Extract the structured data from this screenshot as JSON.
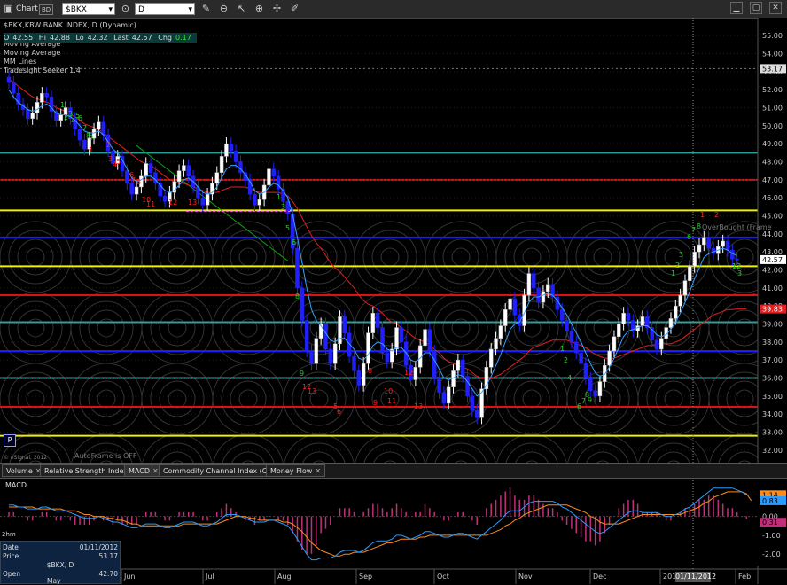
{
  "toolbar": {
    "window_title": "Chart",
    "window_badge": "BD",
    "symbol_value": "$BKX",
    "interval_value": "D",
    "tools": [
      "link-icon",
      "refresh-icon",
      "pencil-icon",
      "zoom-icon",
      "cursor-icon",
      "bell-icon",
      "pin-icon",
      "draw-icon"
    ],
    "window_buttons": [
      "minimize-icon",
      "maximize-icon",
      "close-icon"
    ]
  },
  "study": {
    "title": "$BKX,KBW BANK INDEX, D (Dynamic)",
    "overlay_1": "Moving Average",
    "overlay_2": "Moving Average",
    "overlay_3": "MM Lines",
    "overlay_4": "Tradesight Seeker 1.4",
    "overbought_label": "OverBought (Frame"
  },
  "quote": {
    "open_label": "O",
    "open_value": "42.55",
    "high_label": "Hi",
    "high_value": "42.88",
    "low_label": "Lo",
    "low_value": "42.32",
    "last_label": "Last",
    "last_value": "42.57",
    "chg_label": "Chg",
    "chg_value": "0.17"
  },
  "status": {
    "autoframe": "AutoFrame is OFF",
    "copyright": "© eSignal, 2012",
    "p_button": "P"
  },
  "price_axis": {
    "ticks": [
      "55.00",
      "54.00",
      "53.00",
      "52.00",
      "51.00",
      "50.00",
      "49.00",
      "48.00",
      "47.00",
      "46.00",
      "45.00",
      "44.00",
      "43.00",
      "42.00",
      "41.00",
      "40.00",
      "39.00",
      "38.00",
      "37.00",
      "36.00",
      "35.00",
      "34.00",
      "33.00",
      "32.00"
    ],
    "cursor_price": "53.17",
    "last_price": "42.57",
    "ma_price": "39.83"
  },
  "date_axis": {
    "labels": [
      "Jun",
      "Jul",
      "Aug",
      "Sep",
      "Oct",
      "Nov",
      "Dec",
      "201",
      "Feb"
    ],
    "cursor_date": "01/11/2012"
  },
  "indicator_tabs": [
    {
      "label": "Volume",
      "active": false
    },
    {
      "label": "Relative Strength Index",
      "active": false
    },
    {
      "label": "MACD",
      "active": true
    },
    {
      "label": "Commodity Channel Index (CCI)",
      "active": false
    },
    {
      "label": "Money Flow",
      "active": false
    }
  ],
  "macd": {
    "title": "MACD",
    "axis_ticks": [
      "2.00",
      "1.00",
      "0.00",
      "-1.00",
      "-2.00"
    ],
    "value_macd": "1.14",
    "value_signal": "0.83",
    "value_hist": "0.31",
    "top_left": "2hm"
  },
  "cursor_window": {
    "date_label": "Date",
    "date_value": "01/11/2012",
    "price_label": "Price",
    "price_value": "53.17",
    "symbol_value": "$BKX, D",
    "open_label": "Open",
    "open_value": "42.70",
    "month_label": "May"
  },
  "levels": [
    {
      "price": 48.5,
      "color": "#2aa198"
    },
    {
      "price": 47.0,
      "color": "#e01010"
    },
    {
      "price": 45.3,
      "color": "#f0f000"
    },
    {
      "price": 43.8,
      "color": "#1c1cff"
    },
    {
      "price": 42.2,
      "color": "#f0f000"
    },
    {
      "price": 40.6,
      "color": "#e01010"
    },
    {
      "price": 39.1,
      "color": "#2aa198"
    },
    {
      "price": 37.5,
      "color": "#1c1cff"
    },
    {
      "price": 36.0,
      "color": "#2aa198"
    },
    {
      "price": 34.4,
      "color": "#e01010"
    },
    {
      "price": 32.8,
      "color": "#f0f000"
    }
  ],
  "colors": {
    "candle_up": "#ffffff",
    "candle_down": "#2020ff",
    "ma_fast": "#3aa0ff",
    "ma_slow": "#e02020",
    "ma_long": "#10a010",
    "seek_red": "#ff2020",
    "seek_green": "#20d020"
  },
  "chart_data": {
    "type": "candlestick",
    "ylim": [
      31.5,
      55.5
    ],
    "closes": [
      52.4,
      51.8,
      51.2,
      50.9,
      50.4,
      50.7,
      51.3,
      51.8,
      51.6,
      50.8,
      50.3,
      50.6,
      51.0,
      50.4,
      49.8,
      49.2,
      48.7,
      49.3,
      49.8,
      50.2,
      49.5,
      48.6,
      47.9,
      48.3,
      47.5,
      46.8,
      46.2,
      46.6,
      47.2,
      47.9,
      47.4,
      46.8,
      46.1,
      45.8,
      46.3,
      46.9,
      47.5,
      47.8,
      47.2,
      46.6,
      46.0,
      45.6,
      46.2,
      46.8,
      47.4,
      48.3,
      49.0,
      48.6,
      48.0,
      47.4,
      47.0,
      46.2,
      45.6,
      45.9,
      46.7,
      47.6,
      47.2,
      46.5,
      45.8,
      45.1,
      43.2,
      41.0,
      39.2,
      37.5,
      36.8,
      38.2,
      39.0,
      37.6,
      36.8,
      37.9,
      39.4,
      38.5,
      37.2,
      36.4,
      35.6,
      36.8,
      38.5,
      39.6,
      38.8,
      37.4,
      36.9,
      37.6,
      38.8,
      38.0,
      36.7,
      35.9,
      36.6,
      37.8,
      38.7,
      37.5,
      36.0,
      35.2,
      34.6,
      35.5,
      36.4,
      37.0,
      36.1,
      35.0,
      34.2,
      33.8,
      35.4,
      36.6,
      37.6,
      38.2,
      38.9,
      39.8,
      40.4,
      39.5,
      38.9,
      40.6,
      41.8,
      41.0,
      40.2,
      40.8,
      41.2,
      40.5,
      39.8,
      39.2,
      38.6,
      38.0,
      37.4,
      36.8,
      36.0,
      35.3,
      35.0,
      35.8,
      36.7,
      37.5,
      38.3,
      39.0,
      39.6,
      39.2,
      38.6,
      38.9,
      39.4,
      38.8,
      38.1,
      37.6,
      38.2,
      38.8,
      39.3,
      40.0,
      40.6,
      41.4,
      42.2,
      43.0,
      43.4,
      43.8,
      43.2,
      42.9,
      43.3,
      43.6,
      43.1,
      42.6,
      42.57
    ],
    "ma_fast": [
      52.0,
      51.6,
      51.3,
      51.1,
      50.9,
      50.8,
      50.9,
      51.1,
      51.2,
      51.0,
      50.7,
      50.6,
      50.6,
      50.5,
      50.3,
      50.0,
      49.7,
      49.6,
      49.6,
      49.7,
      49.5,
      49.1,
      48.7,
      48.5,
      48.1,
      47.6,
      47.1,
      46.9,
      47.0,
      47.2,
      47.2,
      47.0,
      46.7,
      46.4,
      46.3,
      46.4,
      46.7,
      47.0,
      47.1,
      46.9,
      46.6,
      46.3,
      46.2,
      46.3,
      46.6,
      47.1,
      47.6,
      47.8,
      47.8,
      47.6,
      47.3,
      46.9,
      46.4,
      46.2,
      46.3,
      46.6,
      46.8,
      46.7,
      46.4,
      46.0,
      45.1,
      43.8,
      42.4,
      41.0,
      39.8,
      39.2,
      38.9,
      38.5,
      38.1,
      38.0,
      38.2,
      38.2,
      37.9,
      37.6,
      37.1,
      37.0,
      37.3,
      37.8,
      38.0,
      37.9,
      37.6,
      37.5,
      37.7,
      37.7,
      37.4,
      37.0,
      36.9,
      37.1,
      37.4,
      37.4,
      37.0,
      36.5,
      36.0,
      35.9,
      36.0,
      36.2,
      36.1,
      35.8,
      35.4,
      35.0,
      35.2,
      35.6,
      36.1,
      36.7,
      37.3,
      38.0,
      38.7,
      39.0,
      39.1,
      39.6,
      40.2,
      40.5,
      40.5,
      40.6,
      40.7,
      40.6,
      40.3,
      39.9,
      39.5,
      39.0,
      38.5,
      38.0,
      37.4,
      36.8,
      36.3,
      36.1,
      36.2,
      36.6,
      37.1,
      37.7,
      38.3,
      38.6,
      38.7,
      38.8,
      38.9,
      38.9,
      38.7,
      38.4,
      38.3,
      38.4,
      38.7,
      39.1,
      39.6,
      40.2,
      40.8,
      41.5,
      42.1,
      42.7,
      42.9,
      43.0,
      43.1,
      43.2,
      43.1,
      42.9,
      42.8
    ],
    "ma_slow": [
      52.6,
      52.4,
      52.2,
      52.0,
      51.8,
      51.6,
      51.5,
      51.4,
      51.3,
      51.2,
      51.0,
      50.9,
      50.8,
      50.6,
      50.5,
      50.3,
      50.1,
      50.0,
      49.9,
      49.8,
      49.6,
      49.4,
      49.2,
      49.0,
      48.8,
      48.6,
      48.4,
      48.2,
      48.0,
      47.9,
      47.8,
      47.6,
      47.4,
      47.2,
      47.0,
      46.9,
      46.8,
      46.8,
      46.7,
      46.6,
      46.5,
      46.4,
      46.3,
      46.3,
      46.3,
      46.4,
      46.5,
      46.6,
      46.6,
      46.6,
      46.6,
      46.5,
      46.4,
      46.3,
      46.3,
      46.3,
      46.3,
      46.3,
      46.2,
      46.1,
      45.8,
      45.4,
      44.9,
      44.4,
      43.9,
      43.5,
      43.2,
      42.8,
      42.4,
      42.1,
      41.9,
      41.6,
      41.3,
      41.0,
      40.6,
      40.3,
      40.1,
      40.0,
      39.8,
      39.6,
      39.3,
      39.1,
      39.0,
      38.8,
      38.6,
      38.4,
      38.2,
      38.1,
      38.0,
      37.8,
      37.6,
      37.4,
      37.1,
      36.9,
      36.8,
      36.7,
      36.6,
      36.5,
      36.3,
      36.1,
      36.0,
      36.0,
      36.0,
      36.1,
      36.2,
      36.4,
      36.6,
      36.8,
      37.0,
      37.2,
      37.5,
      37.7,
      37.8,
      37.9,
      38.0,
      38.1,
      38.1,
      38.1,
      38.1,
      38.0,
      37.9,
      37.8,
      37.7,
      37.5,
      37.3,
      37.2,
      37.1,
      37.1,
      37.1,
      37.2,
      37.3,
      37.4,
      37.5,
      37.6,
      37.7,
      37.8,
      37.8,
      37.9,
      37.9,
      37.9,
      37.9,
      38.0,
      38.1,
      38.3,
      38.5,
      38.7,
      38.9,
      39.1,
      39.3,
      39.5,
      39.6,
      39.7,
      39.8,
      39.8,
      39.83,
      39.83,
      39.83
    ],
    "ma_long": [
      48.9,
      48.7,
      48.5,
      48.3,
      48.1,
      47.9,
      47.7,
      47.5,
      47.3,
      47.1,
      46.9,
      46.7,
      46.5,
      46.3,
      46.1,
      45.9,
      45.7,
      45.5,
      45.3,
      45.1,
      44.9,
      44.7,
      44.5,
      44.3,
      44.1,
      43.9,
      43.7,
      43.5,
      43.3,
      43.1,
      42.9,
      42.7,
      42.5
    ],
    "macd_line": [
      0.6,
      0.6,
      0.5,
      0.5,
      0.4,
      0.4,
      0.4,
      0.5,
      0.5,
      0.4,
      0.3,
      0.3,
      0.3,
      0.2,
      0.1,
      0.0,
      -0.1,
      -0.1,
      -0.1,
      0.0,
      -0.1,
      -0.2,
      -0.3,
      -0.3,
      -0.4,
      -0.5,
      -0.6,
      -0.6,
      -0.5,
      -0.4,
      -0.4,
      -0.4,
      -0.5,
      -0.6,
      -0.6,
      -0.5,
      -0.4,
      -0.3,
      -0.3,
      -0.3,
      -0.4,
      -0.5,
      -0.5,
      -0.4,
      -0.3,
      -0.1,
      0.1,
      0.1,
      0.1,
      0.0,
      -0.1,
      -0.2,
      -0.3,
      -0.3,
      -0.3,
      -0.2,
      -0.2,
      -0.3,
      -0.4,
      -0.5,
      -0.8,
      -1.2,
      -1.6,
      -2.0,
      -2.3,
      -2.3,
      -2.2,
      -2.2,
      -2.2,
      -2.1,
      -1.9,
      -1.8,
      -1.8,
      -1.8,
      -1.9,
      -1.8,
      -1.6,
      -1.4,
      -1.3,
      -1.3,
      -1.3,
      -1.2,
      -1.0,
      -1.0,
      -1.1,
      -1.2,
      -1.1,
      -1.0,
      -0.8,
      -0.8,
      -0.9,
      -1.0,
      -1.1,
      -1.1,
      -1.0,
      -0.9,
      -0.9,
      -1.0,
      -1.1,
      -1.2,
      -1.0,
      -0.8,
      -0.6,
      -0.4,
      -0.2,
      0.1,
      0.3,
      0.3,
      0.3,
      0.5,
      0.7,
      0.8,
      0.8,
      0.8,
      0.8,
      0.8,
      0.7,
      0.5,
      0.4,
      0.2,
      0.0,
      -0.2,
      -0.4,
      -0.6,
      -0.8,
      -0.9,
      -0.8,
      -0.6,
      -0.4,
      -0.2,
      0.0,
      0.2,
      0.3,
      0.3,
      0.2,
      0.2,
      0.2,
      0.2,
      0.1,
      0.0,
      0.0,
      0.1,
      0.2,
      0.4,
      0.5,
      0.7,
      0.9,
      1.1,
      1.3,
      1.5,
      1.5,
      1.5,
      1.5,
      1.5,
      1.4,
      1.3,
      1.14
    ],
    "signal_line": [
      0.5,
      0.5,
      0.5,
      0.5,
      0.5,
      0.5,
      0.4,
      0.4,
      0.4,
      0.4,
      0.4,
      0.4,
      0.3,
      0.3,
      0.3,
      0.2,
      0.1,
      0.1,
      0.0,
      0.0,
      0.0,
      -0.1,
      -0.1,
      -0.2,
      -0.2,
      -0.3,
      -0.4,
      -0.4,
      -0.5,
      -0.5,
      -0.5,
      -0.5,
      -0.5,
      -0.5,
      -0.5,
      -0.5,
      -0.5,
      -0.4,
      -0.4,
      -0.4,
      -0.4,
      -0.4,
      -0.4,
      -0.4,
      -0.4,
      -0.3,
      -0.2,
      -0.1,
      0.0,
      0.0,
      0.0,
      -0.1,
      -0.1,
      -0.2,
      -0.2,
      -0.2,
      -0.2,
      -0.2,
      -0.3,
      -0.3,
      -0.4,
      -0.6,
      -0.8,
      -1.1,
      -1.4,
      -1.6,
      -1.8,
      -1.9,
      -2.0,
      -2.1,
      -2.1,
      -2.0,
      -2.0,
      -1.9,
      -1.9,
      -1.9,
      -1.8,
      -1.7,
      -1.6,
      -1.5,
      -1.4,
      -1.4,
      -1.3,
      -1.2,
      -1.2,
      -1.2,
      -1.2,
      -1.1,
      -1.1,
      -1.0,
      -1.0,
      -1.0,
      -1.0,
      -1.0,
      -1.0,
      -1.0,
      -1.0,
      -1.0,
      -1.0,
      -1.0,
      -1.0,
      -1.0,
      -0.9,
      -0.8,
      -0.7,
      -0.5,
      -0.4,
      -0.2,
      -0.1,
      0.1,
      0.2,
      0.3,
      0.4,
      0.5,
      0.6,
      0.6,
      0.6,
      0.6,
      0.6,
      0.5,
      0.4,
      0.3,
      0.2,
      0.0,
      -0.1,
      -0.3,
      -0.4,
      -0.4,
      -0.4,
      -0.4,
      -0.3,
      -0.2,
      -0.1,
      0.0,
      0.1,
      0.1,
      0.1,
      0.1,
      0.1,
      0.1,
      0.1,
      0.1,
      0.1,
      0.2,
      0.3,
      0.4,
      0.5,
      0.7,
      0.8,
      1.0,
      1.1,
      1.2,
      1.3,
      1.3,
      1.3,
      1.3,
      1.2,
      0.83
    ],
    "seeker_red": [
      [
        100,
        172,
        "1"
      ],
      [
        120,
        166,
        "2"
      ],
      [
        122,
        182,
        "3"
      ],
      [
        127,
        188,
        "4"
      ],
      [
        131,
        185,
        "5"
      ],
      [
        146,
        200,
        "6"
      ],
      [
        148,
        206,
        "7"
      ],
      [
        154,
        208,
        "8"
      ],
      [
        160,
        228,
        "10"
      ],
      [
        165,
        233,
        "11"
      ],
      [
        190,
        231,
        "12"
      ],
      [
        212,
        231,
        "13"
      ],
      [
        341,
        439,
        "12"
      ],
      [
        347,
        444,
        "13"
      ],
      [
        376,
        461,
        "5"
      ],
      [
        380,
        467,
        "6"
      ],
      [
        415,
        421,
        "8"
      ],
      [
        421,
        457,
        "9"
      ],
      [
        433,
        444,
        "10"
      ],
      [
        437,
        455,
        "11"
      ],
      [
        456,
        423,
        "12"
      ],
      [
        467,
        461,
        "13"
      ],
      [
        790,
        245,
        "1"
      ],
      [
        806,
        245,
        "2"
      ]
    ],
    "seeker_green": [
      [
        68,
        121,
        "1"
      ],
      [
        72,
        135,
        "2"
      ],
      [
        77,
        131,
        "3"
      ],
      [
        80,
        139,
        "4"
      ],
      [
        85,
        133,
        "5"
      ],
      [
        88,
        136,
        "6"
      ],
      [
        93,
        147,
        "7"
      ],
      [
        97,
        156,
        "8"
      ],
      [
        100,
        158,
        "9"
      ],
      [
        312,
        225,
        "1"
      ],
      [
        317,
        236,
        "3"
      ],
      [
        322,
        260,
        "5"
      ],
      [
        329,
        276,
        "6"
      ],
      [
        333,
        337,
        "8"
      ],
      [
        338,
        424,
        "9"
      ],
      [
        632,
        396,
        "1"
      ],
      [
        636,
        409,
        "2"
      ],
      [
        640,
        429,
        "4"
      ],
      [
        651,
        461,
        "6"
      ],
      [
        656,
        455,
        "7"
      ],
      [
        660,
        448,
        "8"
      ],
      [
        663,
        454,
        "9"
      ],
      [
        757,
        311,
        "1"
      ],
      [
        762,
        302,
        "2"
      ],
      [
        766,
        290,
        "3"
      ],
      [
        775,
        270,
        "6"
      ],
      [
        780,
        262,
        "7"
      ],
      [
        786,
        258,
        "8"
      ],
      [
        826,
        303,
        "12"
      ],
      [
        832,
        311,
        "3"
      ]
    ]
  }
}
